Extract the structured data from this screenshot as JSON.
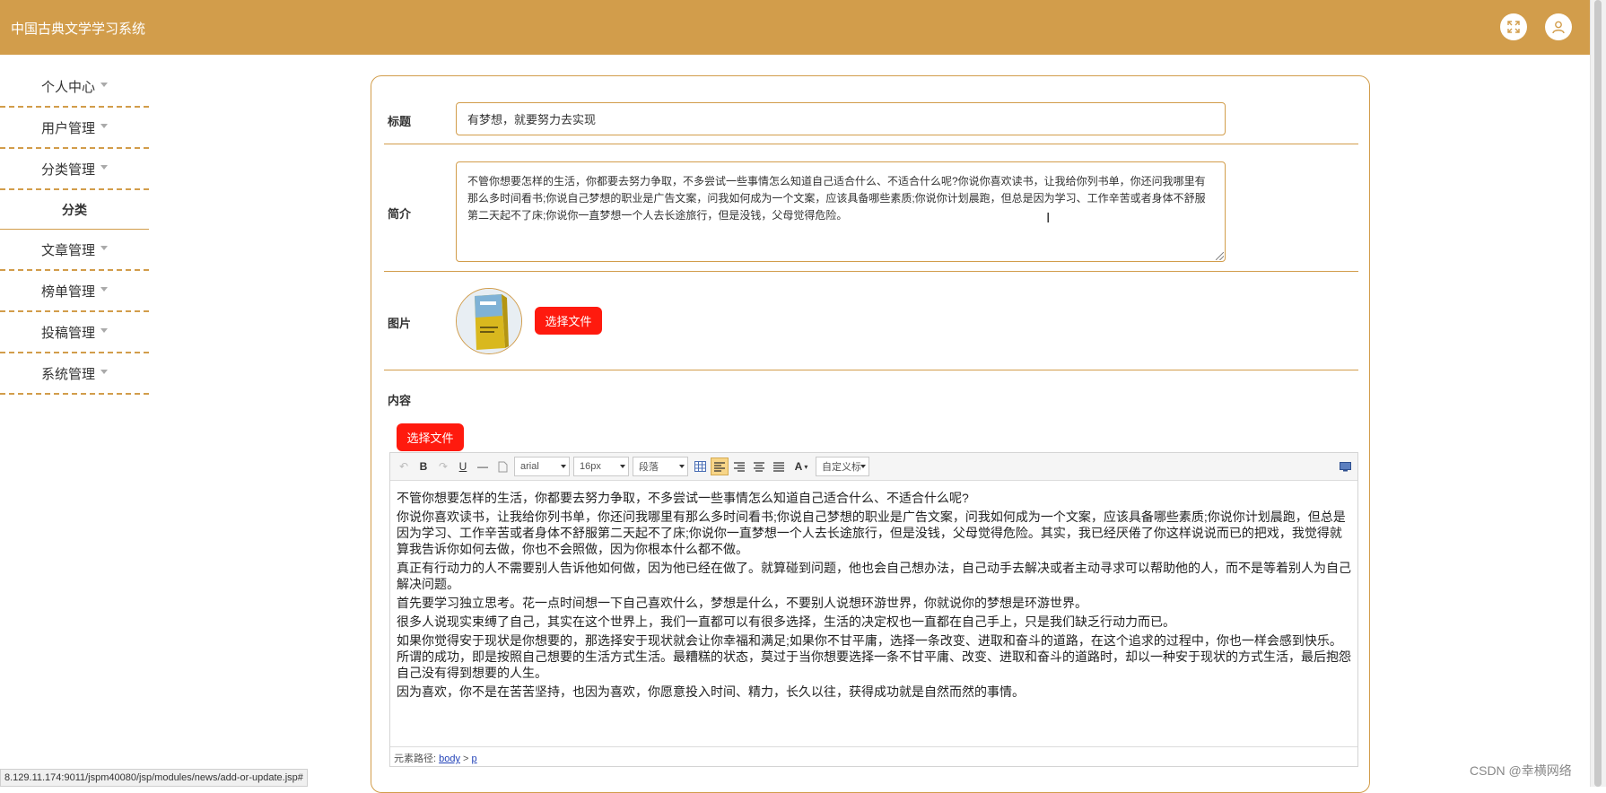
{
  "app": {
    "title": "中国古典文学学习系统"
  },
  "sidebar": {
    "items": [
      {
        "label": "个人中心"
      },
      {
        "label": "用户管理"
      },
      {
        "label": "分类管理"
      },
      {
        "label": "分类"
      },
      {
        "label": "文章管理"
      },
      {
        "label": "榜单管理"
      },
      {
        "label": "投稿管理"
      },
      {
        "label": "系统管理"
      }
    ]
  },
  "form": {
    "title_label": "标题",
    "title_value": "有梦想，就要努力去实现",
    "summary_label": "简介",
    "summary_value": "不管你想要怎样的生活，你都要去努力争取，不多尝试一些事情怎么知道自己适合什么、不适合什么呢?你说你喜欢读书，让我给你列书单，你还问我哪里有那么多时间看书;你说自己梦想的职业是广告文案，问我如何成为一个文案，应该具备哪些素质;你说你计划晨跑，但总是因为学习、工作辛苦或者身体不舒服第二天起不了床;你说你一直梦想一个人去长途旅行，但是没钱，父母觉得危险。",
    "picture_label": "图片",
    "picture_button": "选择文件",
    "content_label": "内容",
    "content_button": "选择文件"
  },
  "editor": {
    "font_family": "arial",
    "font_size": "16px",
    "paragraph": "段落",
    "custom_title": "自定义标题",
    "paragraphs": [
      "不管你想要怎样的生活，你都要去努力争取，不多尝试一些事情怎么知道自己适合什么、不适合什么呢?",
      "你说你喜欢读书，让我给你列书单，你还问我哪里有那么多时间看书;你说自己梦想的职业是广告文案，问我如何成为一个文案，应该具备哪些素质;你说你计划晨跑，但总是因为学习、工作辛苦或者身体不舒服第二天起不了床;你说你一直梦想一个人去长途旅行，但是没钱，父母觉得危险。其实，我已经厌倦了你这样说说而已的把戏，我觉得就算我告诉你如何去做，你也不会照做，因为你根本什么都不做。",
      "真正有行动力的人不需要别人告诉他如何做，因为他已经在做了。就算碰到问题，他也会自己想办法，自己动手去解决或者主动寻求可以帮助他的人，而不是等着别人为自己解决问题。",
      "首先要学习独立思考。花一点时间想一下自己喜欢什么，梦想是什么，不要别人说想环游世界，你就说你的梦想是环游世界。",
      "很多人说现实束缚了自己，其实在这个世界上，我们一直都可以有很多选择，生活的决定权也一直都在自己手上，只是我们缺乏行动力而已。",
      "如果你觉得安于现状是你想要的，那选择安于现状就会让你幸福和满足;如果你不甘平庸，选择一条改变、进取和奋斗的道路，在这个追求的过程中，你也一样会感到快乐。所谓的成功，即是按照自己想要的生活方式生活。最糟糕的状态，莫过于当你想要选择一条不甘平庸、改变、进取和奋斗的道路时，却以一种安于现状的方式生活，最后抱怨自己没有得到想要的人生。",
      "因为喜欢，你不是在苦苦坚持，也因为喜欢，你愿意投入时间、精力，长久以往，获得成功就是自然而然的事情。"
    ],
    "status_prefix": "元素路径:",
    "status_path_1": "body",
    "status_sep": ">",
    "status_path_2": "p"
  },
  "statusbar": {
    "url": "8.129.11.174:9011/jspm40080/jsp/modules/news/add-or-update.jsp#"
  },
  "watermark": "CSDN @幸横网络",
  "colors": {
    "accent": "#d29d4b",
    "button_red": "#ff1a0e"
  }
}
